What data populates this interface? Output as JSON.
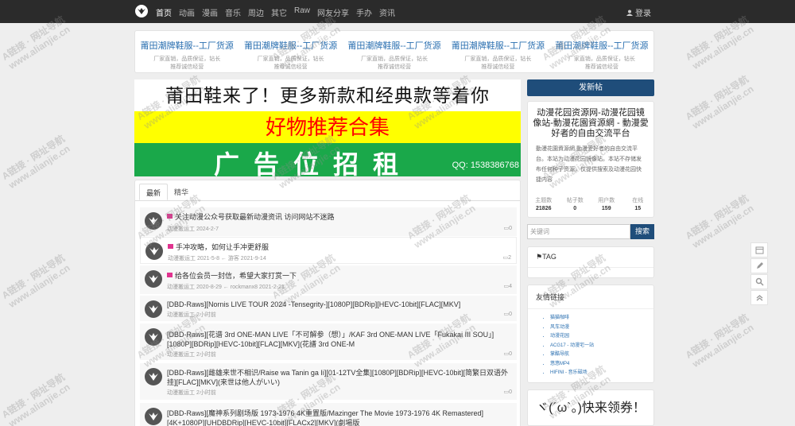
{
  "nav": {
    "items": [
      "首页",
      "动画",
      "漫画",
      "音乐",
      "周边",
      "其它",
      "Raw",
      "网友分享",
      "手办",
      "资讯"
    ],
    "active_index": 0,
    "login": "登录"
  },
  "ad_links": [
    {
      "title": "莆田潮牌鞋服--工厂货源",
      "sub": "厂家直销，品质保证，钻长推荐诚信经营"
    },
    {
      "title": "莆田潮牌鞋服--工厂货源",
      "sub": "厂家直销，品质保证，钻长推荐诚信经营"
    },
    {
      "title": "莆田潮牌鞋服--工厂货源",
      "sub": "厂家直销，品质保证，钻长推荐诚信经营"
    },
    {
      "title": "莆田潮牌鞋服--工厂货源",
      "sub": "厂家直销，品质保证，钻长推荐诚信经营"
    },
    {
      "title": "莆田潮牌鞋服--工厂货源",
      "sub": "厂家直销，品质保证，钻长推荐诚信经营"
    }
  ],
  "banner": {
    "line1": "莆田鞋来了！更多新款和经典款等着你",
    "line2": "好物推荐合集",
    "line3": "广告位招租",
    "qq": "QQ: 1538386768"
  },
  "tabs": [
    "最新",
    "精华"
  ],
  "posts": [
    {
      "title": "关注动漫公众号获取最新动漫资讯 访问网站不迷路",
      "meta": "动漫搬运工  2024-2-7",
      "count": "0",
      "pinned": true
    },
    {
      "title": "手冲攻略，如何让手冲更舒服",
      "meta": "动漫搬运工  2021-5-8  ←  游客  2021-9-14",
      "count": "2",
      "pinned": true
    },
    {
      "title": "给各位会员一封信，希望大家打赏一下",
      "meta": "动漫搬运工  2020-8-29  ←  rockmanx8  2021-2-21",
      "count": "4",
      "pinned": true
    },
    {
      "title": "[DBD-Raws][Nornis LIVE TOUR 2024 -Tensegrity-][1080P][BDRip][HEVC-10bit][FLAC][MKV]",
      "meta": "动漫搬运工  2小时前",
      "count": "0",
      "pinned": false
    },
    {
      "title": "[DBD-Raws][花谱 3rd ONE-MAN LIVE「不可解参（想）」/KAF 3rd ONE-MAN LIVE「Fukakai III SOU」][1080P][BDRip][HEVC-10bit][FLAC][MKV](花譜 3rd ONE-M",
      "meta": "动漫搬运工  2小时前",
      "count": "0",
      "pinned": false
    },
    {
      "title": "[DBD-Raws][雌雄来世不相识/Raise wa Tanin ga Ii][01-12TV全集][1080P][BDRip][HEVC-10bit][简繁日双语外挂][FLAC][MKV](来世は他人がいい)",
      "meta": "动漫搬运工  2小时前",
      "count": "0",
      "pinned": false
    },
    {
      "title": "[DBD-Raws][魔神系列剧场版 1973-1976 4K重置版/Mazinger The Movie 1973-1976 4K Remastered][4K+1080P][UHDBDRip][HEVC-10bit][FLACx2][MKV](劇場版",
      "meta": "",
      "count": "",
      "pinned": false
    }
  ],
  "sidebar": {
    "new_post": "发新帖",
    "site_title": "动漫花园资源网-动漫花园镜像站-動漫花園資源網 - 動漫愛好者的自由交流平台",
    "site_desc": "動漫花園資源網,動漫愛好者的自由交流平台。本站为动漫花园镜像站。本站不存储发布任何种子资源，仅提供搜索及动漫花园快捷内容",
    "stats": [
      {
        "label": "主题数",
        "value": "21826"
      },
      {
        "label": "帖子数",
        "value": "0"
      },
      {
        "label": "用户数",
        "value": "159"
      },
      {
        "label": "在线",
        "value": "15"
      }
    ],
    "search_placeholder": "关键词",
    "search_button": "搜索",
    "tag_title": "TAG",
    "links_title": "友情链接",
    "links": [
      "猫猫咖啡",
      "风车动漫",
      "动漫花园",
      "ACG17 - 动漫宅一站",
      "掌酷导航",
      "悠悠MP4",
      "HIFINI - 音乐磁场"
    ],
    "promo": "ヾ(´ω`。)快来领券！"
  },
  "watermark": {
    "line1": "A链接 · 网址导航",
    "line2": "www.alianjie.cn"
  }
}
